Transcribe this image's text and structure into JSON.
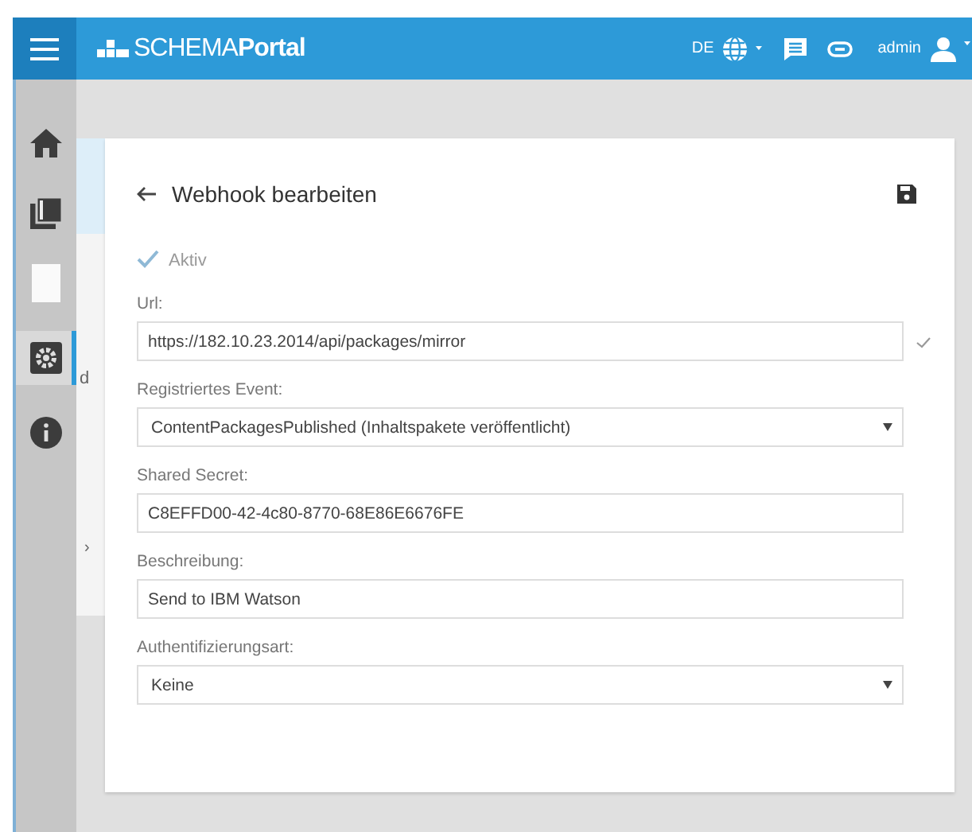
{
  "header": {
    "brand_light": "SCHEMA",
    "brand_bold": "Portal",
    "language": "DE",
    "user": "admin"
  },
  "sidebar": {
    "items": [
      {
        "selected": false
      },
      {
        "selected": false
      },
      {
        "selected": false
      },
      {
        "selected": true
      },
      {
        "selected": false
      }
    ]
  },
  "background_panel": {
    "text": "d",
    "toggle": "›"
  },
  "form": {
    "title": "Webhook bearbeiten",
    "active": {
      "label": "Aktiv",
      "checked": true
    },
    "fields": [
      {
        "kind": "text",
        "label": "Url:",
        "value": "https://182.10.23.2014/api/packages/mirror",
        "valid": true
      },
      {
        "kind": "select",
        "label": "Registriertes Event:",
        "value": "ContentPackagesPublished (Inhaltspakete veröffentlicht)",
        "valid": false
      },
      {
        "kind": "text",
        "label": "Shared Secret:",
        "value": "C8EFFD00-42-4c80-8770-68E86E6676FE",
        "valid": false
      },
      {
        "kind": "text",
        "label": "Beschreibung:",
        "value": "Send to IBM Watson",
        "valid": false
      },
      {
        "kind": "select",
        "label": "Authentifizierungsart:",
        "value": "Keine",
        "valid": false
      }
    ]
  }
}
